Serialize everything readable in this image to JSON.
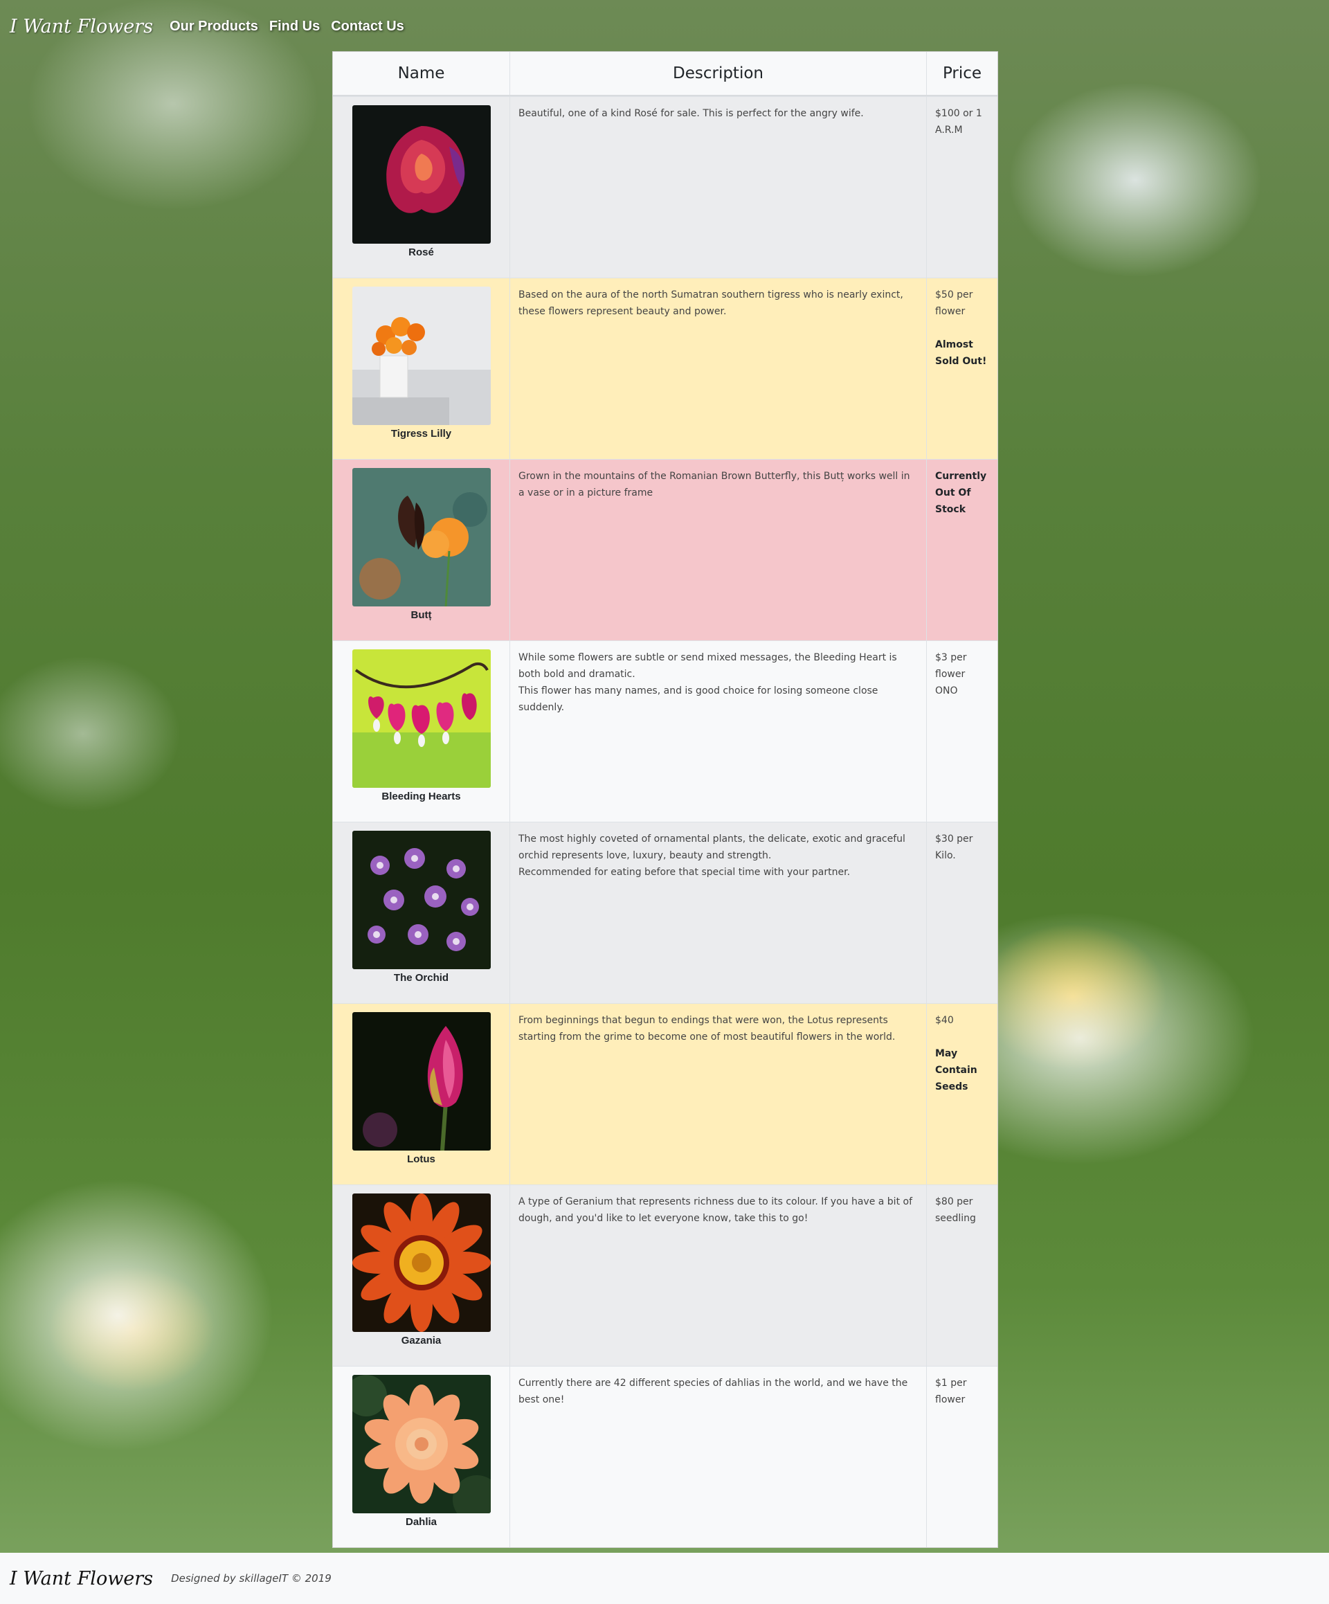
{
  "nav": {
    "brand": "I Want Flowers",
    "links": [
      "Our Products",
      "Find Us",
      "Contact Us"
    ]
  },
  "table": {
    "headers": [
      "Name",
      "Description",
      "Price"
    ],
    "rows": [
      {
        "name": "Rosé",
        "description": [
          "Beautiful, one of a kind Rosé for sale. This is perfect for the angry wife."
        ],
        "price": "$100 or 1 A.R.M",
        "note": "",
        "style": "grey",
        "image": "rose-image"
      },
      {
        "name": "Tigress Lilly",
        "description": [
          "Based on the aura of the north Sumatran southern tigress who is nearly exinct, these flowers represent beauty and power."
        ],
        "price": "$50 per flower",
        "note": "Almost Sold Out!",
        "style": "warn",
        "image": "lilly-image"
      },
      {
        "name": "Butț",
        "description": [
          "Grown in the mountains of the Romanian Brown Butterfly, this Butț works well in a vase or in a picture frame"
        ],
        "price": "",
        "note": "Currently Out Of Stock",
        "style": "danger",
        "image": "butterfly-image"
      },
      {
        "name": "Bleeding Hearts",
        "description": [
          "While some flowers are subtle or send mixed messages, the Bleeding Heart is both bold and dramatic.",
          "This flower has many names, and is good choice for losing someone close suddenly."
        ],
        "price": "$3 per flower ONO",
        "note": "",
        "style": "light",
        "image": "bleeding-hearts-image"
      },
      {
        "name": "The Orchid",
        "description": [
          "The most highly coveted of ornamental plants, the delicate, exotic and graceful orchid represents love, luxury, beauty and strength.",
          "Recommended for eating before that special time with your partner."
        ],
        "price": "$30 per Kilo.",
        "note": "",
        "style": "grey",
        "image": "orchid-image"
      },
      {
        "name": "Lotus",
        "description": [
          "From beginnings that begun to endings that were won, the Lotus represents starting from the grime to become one of most beautiful flowers in the world."
        ],
        "price": "$40",
        "note": "May Contain Seeds",
        "style": "warn",
        "image": "lotus-image"
      },
      {
        "name": "Gazania",
        "description": [
          "A type of Geranium that represents richness due to its colour. If you have a bit of dough, and you'd like to let everyone know, take this to go!"
        ],
        "price": "$80 per seedling",
        "note": "",
        "style": "grey",
        "image": "gazania-image"
      },
      {
        "name": "Dahlia",
        "description": [
          "Currently there are 42 different species of dahlias in the world, and we have the best one!"
        ],
        "price": "$1 per flower",
        "note": "",
        "style": "light",
        "image": "dahlia-image"
      }
    ]
  },
  "footer": {
    "brand": "I Want Flowers",
    "credit": "Designed by skillageIT © 2019"
  }
}
